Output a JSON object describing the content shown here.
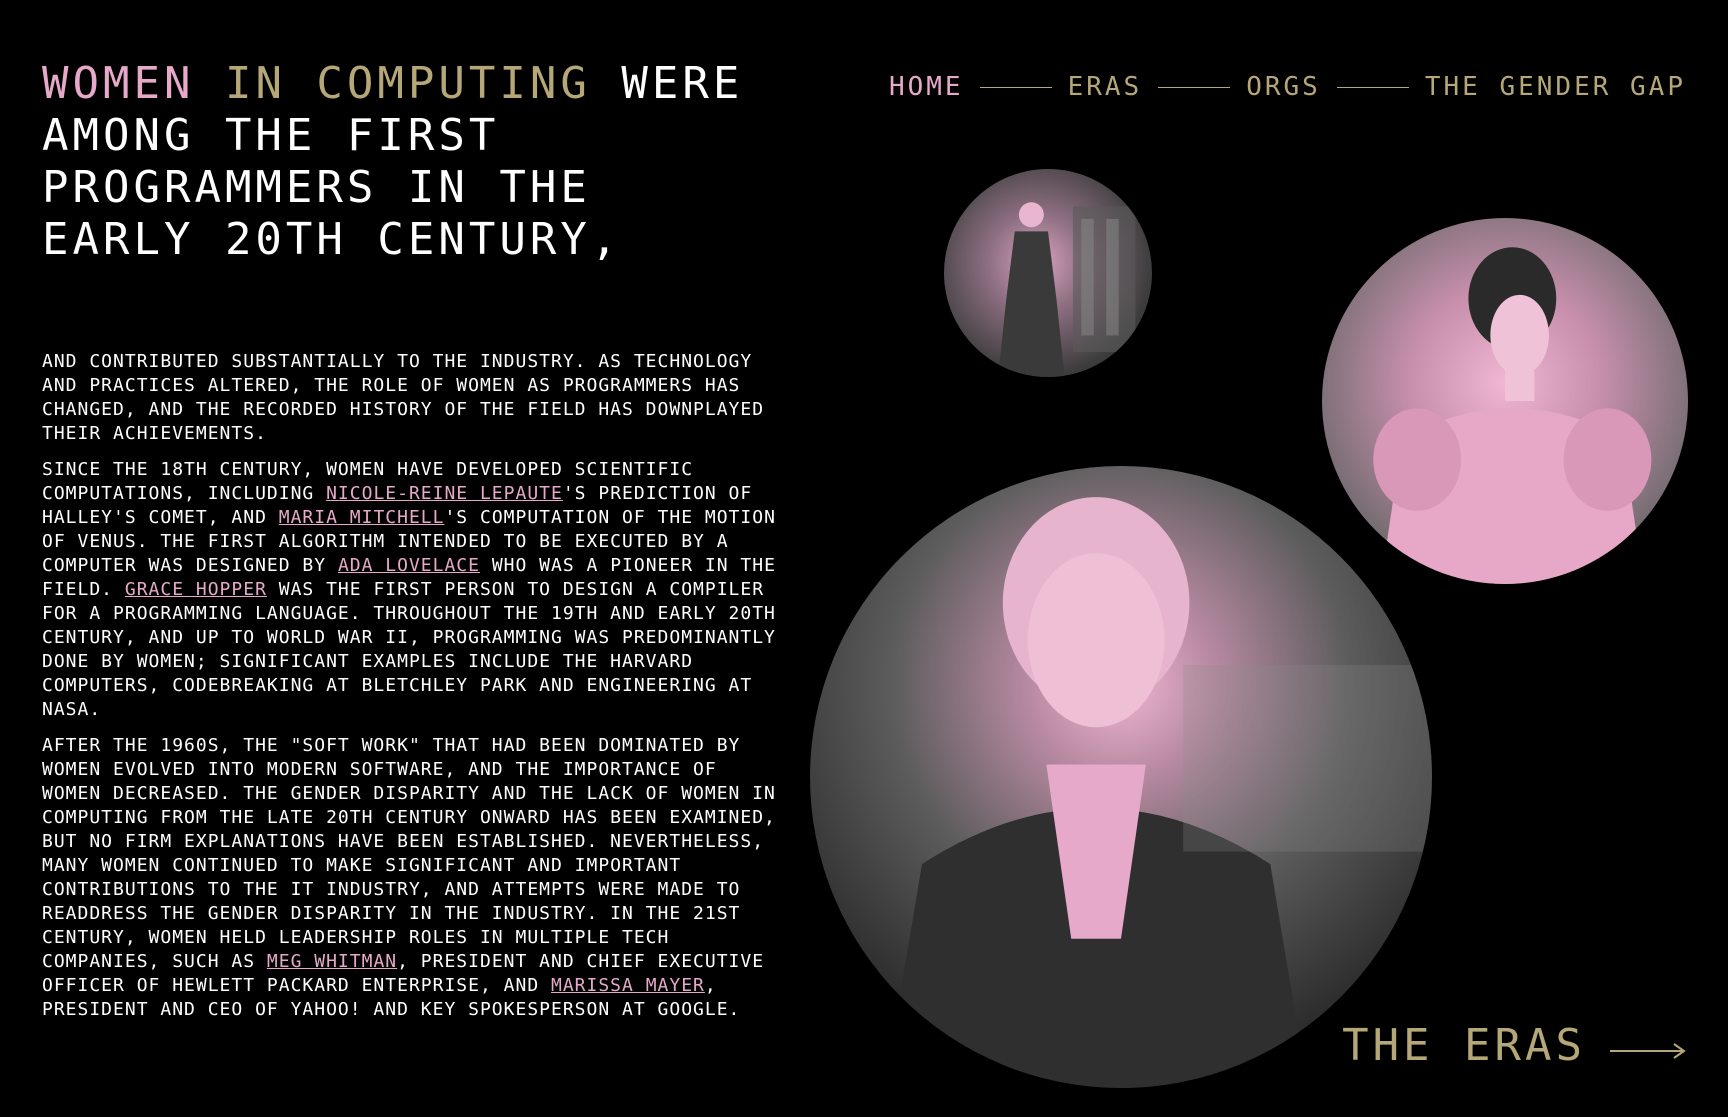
{
  "hero": {
    "word1": "WOMEN",
    "word2": "IN COMPUTING",
    "rest": "WERE AMONG THE FIRST PROGRAMMERS IN THE EARLY 20TH CENTURY,"
  },
  "nav": {
    "home": "HOME",
    "eras": "ERAS",
    "orgs": "ORGS",
    "gender_gap": "THE GENDER GAP"
  },
  "paragraph1": "AND CONTRIBUTED SUBSTANTIALLY TO THE INDUSTRY. AS TECHNOLOGY AND PRACTICES ALTERED, THE ROLE OF WOMEN AS PROGRAMMERS HAS CHANGED, AND THE RECORDED HISTORY OF THE FIELD HAS DOWNPLAYED THEIR ACHIEVEMENTS.",
  "paragraph2": {
    "t1": "SINCE THE 18TH CENTURY, WOMEN HAVE DEVELOPED SCIENTIFIC COMPUTATIONS, INCLUDING ",
    "link1": "NICOLE-REINE LEPAUTE",
    "t2": "'S PREDICTION OF HALLEY'S COMET, AND ",
    "link2": "MARIA MITCHELL",
    "t3": "'S COMPUTATION OF THE MOTION OF VENUS. THE FIRST ALGORITHM INTENDED TO BE EXECUTED BY A COMPUTER WAS DESIGNED BY ",
    "link3": "ADA LOVELACE",
    "t4": " WHO WAS A PIONEER IN THE FIELD. ",
    "link4": "GRACE HOPPER",
    "t5": " WAS THE FIRST PERSON TO DESIGN A COMPILER FOR A PROGRAMMING LANGUAGE. THROUGHOUT THE 19TH AND EARLY 20TH CENTURY, AND UP TO WORLD WAR II, PROGRAMMING WAS PREDOMINANTLY DONE BY WOMEN; SIGNIFICANT EXAMPLES INCLUDE THE HARVARD COMPUTERS, CODEBREAKING AT BLETCHLEY PARK AND ENGINEERING AT NASA."
  },
  "paragraph3": {
    "t1": "AFTER THE 1960S, THE \"SOFT WORK\" THAT HAD BEEN DOMINATED BY WOMEN EVOLVED INTO MODERN SOFTWARE, AND THE IMPORTANCE OF WOMEN DECREASED. THE GENDER DISPARITY AND THE LACK OF WOMEN IN COMPUTING FROM THE LATE 20TH CENTURY ONWARD HAS BEEN EXAMINED, BUT NO FIRM EXPLANATIONS HAVE BEEN ESTABLISHED. NEVERTHELESS, MANY WOMEN CONTINUED TO MAKE SIGNIFICANT AND IMPORTANT CONTRIBUTIONS TO THE IT INDUSTRY, AND ATTEMPTS WERE MADE TO READDRESS THE GENDER DISPARITY IN THE INDUSTRY. IN THE 21ST CENTURY, WOMEN HELD LEADERSHIP ROLES IN MULTIPLE TECH COMPANIES, SUCH AS ",
    "link1": "MEG WHITMAN",
    "t2": ", PRESIDENT AND CHIEF EXECUTIVE OFFICER OF HEWLETT PACKARD ENTERPRISE, AND ",
    "link2": "MARISSA MAYER",
    "t3": ", PRESIDENT AND CEO OF YAHOO! AND KEY SPOKESPERSON AT GOOGLE."
  },
  "cta": {
    "label": "THE ERAS",
    "icon": "arrow-right-icon"
  },
  "colors": {
    "background": "#000000",
    "pink_accent": "#e6a9c9",
    "gold_accent": "#b5a778",
    "text": "#ffffff"
  },
  "icons": [
    "arrow-right-icon"
  ]
}
